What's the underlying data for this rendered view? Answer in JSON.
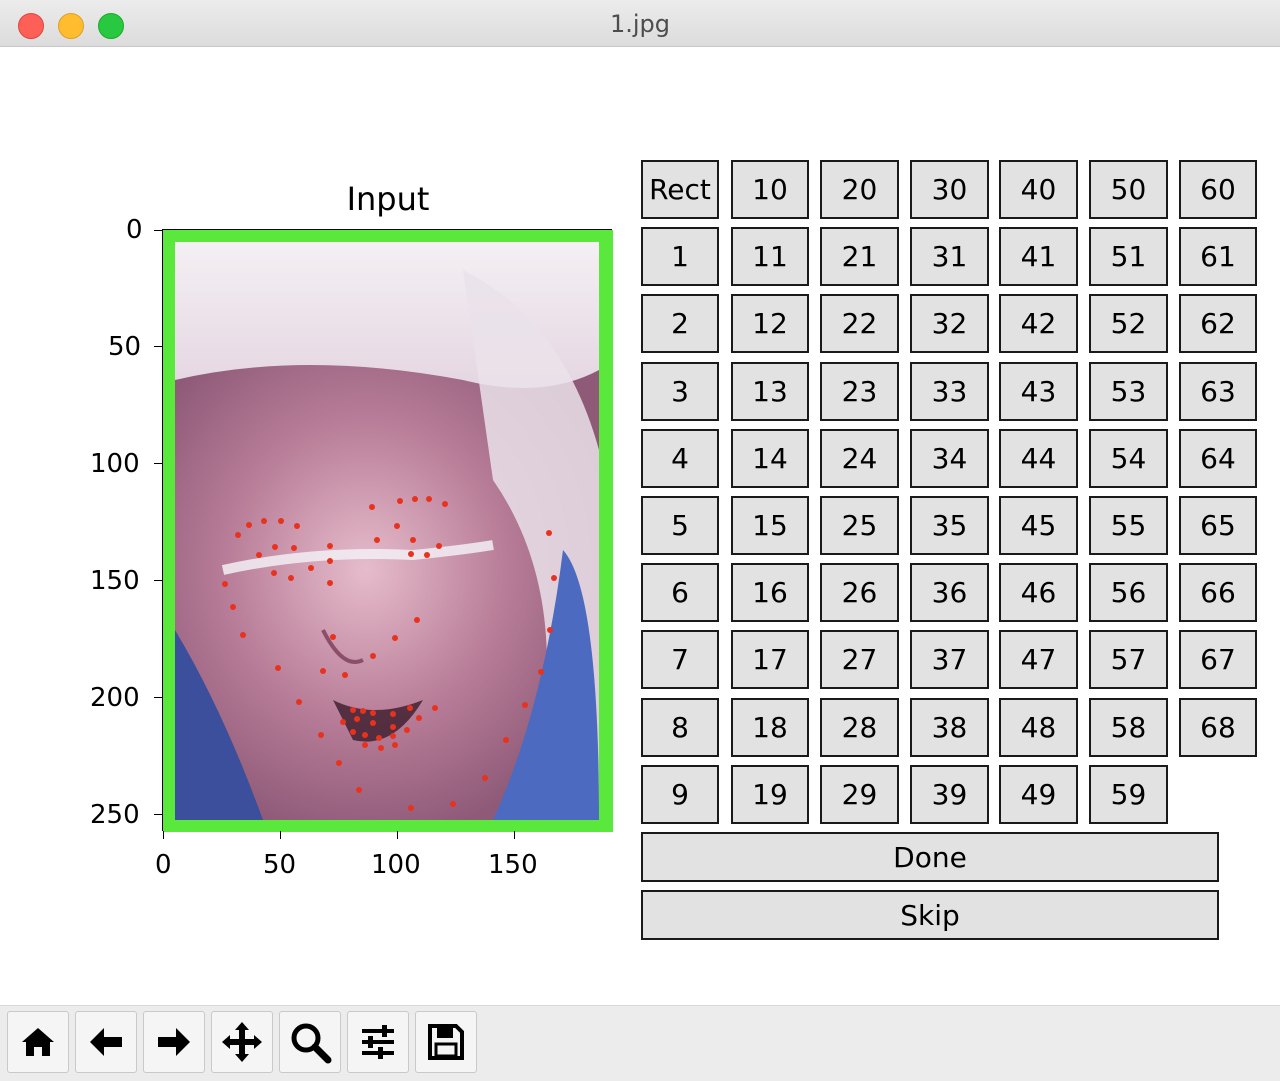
{
  "window": {
    "title": "1.jpg"
  },
  "plot": {
    "title": "Input",
    "y_ticks": [
      "0",
      "50",
      "100",
      "150",
      "200",
      "250"
    ],
    "x_ticks": [
      "0",
      "50",
      "100",
      "150"
    ],
    "frame_color": "#5ae83d",
    "landmark_color": "#e8321e"
  },
  "buttons": {
    "rect": "Rect",
    "numbers": [
      "1",
      "2",
      "3",
      "4",
      "5",
      "6",
      "7",
      "8",
      "9",
      "10",
      "11",
      "12",
      "13",
      "14",
      "15",
      "16",
      "17",
      "18",
      "19",
      "20",
      "21",
      "22",
      "23",
      "24",
      "25",
      "26",
      "27",
      "28",
      "29",
      "30",
      "31",
      "32",
      "33",
      "34",
      "35",
      "36",
      "37",
      "38",
      "39",
      "40",
      "41",
      "42",
      "43",
      "44",
      "45",
      "46",
      "47",
      "48",
      "49",
      "50",
      "51",
      "52",
      "53",
      "54",
      "55",
      "56",
      "57",
      "58",
      "59",
      "60",
      "61",
      "62",
      "63",
      "64",
      "65",
      "66",
      "67",
      "68"
    ],
    "done": "Done",
    "skip": "Skip"
  },
  "toolbar": {
    "icons": [
      "home-icon",
      "back-arrow-icon",
      "forward-arrow-icon",
      "pan-icon",
      "zoom-icon",
      "configure-subplots-icon",
      "save-icon"
    ]
  }
}
